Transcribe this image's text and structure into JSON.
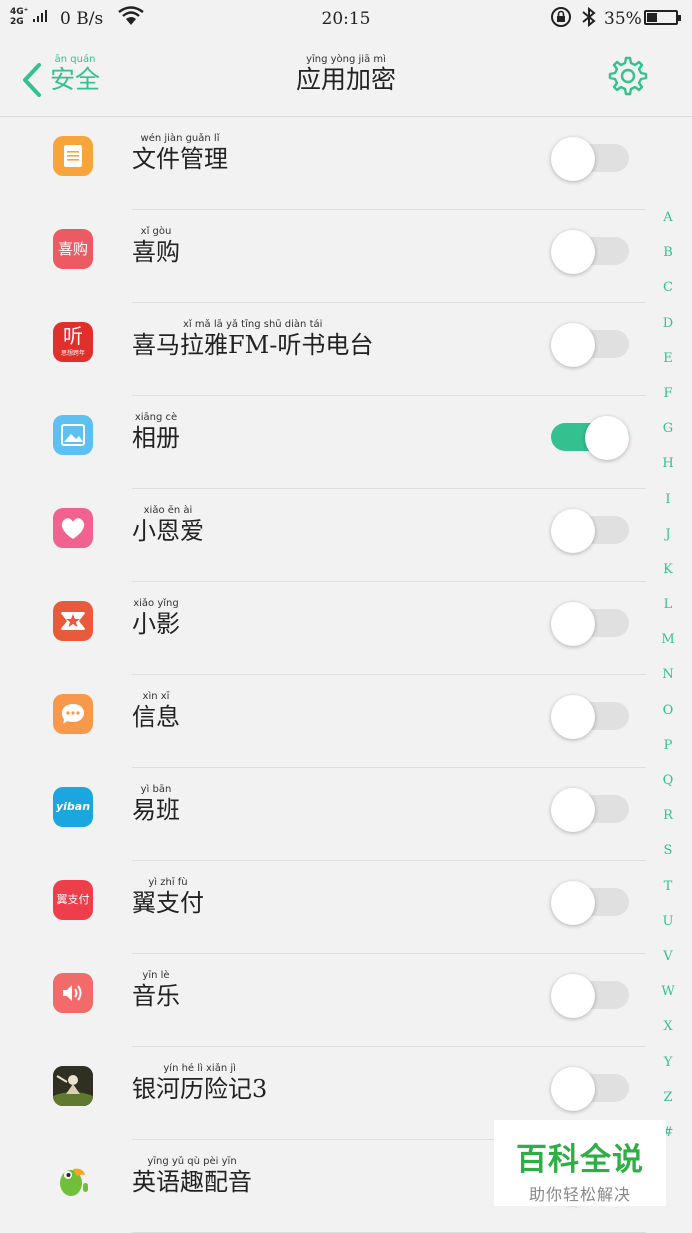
{
  "status_bar": {
    "network_top": "4G⁺",
    "network_bottom": "2G",
    "speed": "0 B/s",
    "time": "20:15",
    "battery": "35%",
    "battery_level": 0.35
  },
  "header": {
    "back_label": "安全",
    "back_pinyin": "ān quán",
    "title": "应用加密",
    "title_pinyin": "yīng yòng jiā mì",
    "accent_color": "#35c18f"
  },
  "apps": [
    {
      "name": "文件管理",
      "pinyin": "wén jiàn guǎn lǐ",
      "enabled": false,
      "icon": "file-manager-icon"
    },
    {
      "name": "喜购",
      "pinyin": "xǐ gòu",
      "enabled": false,
      "icon": "xigou-icon"
    },
    {
      "name": "喜马拉雅FM-听书电台",
      "pinyin": "xǐ mǎ lā yǎ tīng shū diàn tái",
      "enabled": false,
      "icon": "ximalaya-icon"
    },
    {
      "name": "相册",
      "pinyin": "xiāng cè",
      "enabled": true,
      "icon": "photos-icon"
    },
    {
      "name": "小恩爱",
      "pinyin": "xiǎo ēn ài",
      "enabled": false,
      "icon": "heart-icon"
    },
    {
      "name": "小影",
      "pinyin": "xiǎo yǐng",
      "enabled": false,
      "icon": "video-star-icon"
    },
    {
      "name": "信息",
      "pinyin": "xìn xī",
      "enabled": false,
      "icon": "message-icon"
    },
    {
      "name": "易班",
      "pinyin": "yì bān",
      "enabled": false,
      "icon": "yiban-icon"
    },
    {
      "name": "翼支付",
      "pinyin": "yì zhī fù",
      "enabled": false,
      "icon": "yizhifu-icon"
    },
    {
      "name": "音乐",
      "pinyin": "yīn lè",
      "enabled": false,
      "icon": "speaker-icon"
    },
    {
      "name": "银河历险记3",
      "pinyin": "yín hé lì xiǎn jì",
      "enabled": false,
      "icon": "game-icon"
    },
    {
      "name": "英语趣配音",
      "pinyin": "yīng yǔ qù pèi yīn",
      "enabled": false,
      "icon": "parrot-icon"
    }
  ],
  "icon_labels": {
    "xigou": "喜购",
    "ximalaya_main": "听",
    "ximalaya_sub": "思想跨年",
    "yiban": "yiban",
    "yizhifu": "翼支付"
  },
  "alpha_index": [
    "A",
    "B",
    "C",
    "D",
    "E",
    "F",
    "G",
    "H",
    "I",
    "J",
    "K",
    "L",
    "M",
    "N",
    "O",
    "P",
    "Q",
    "R",
    "S",
    "T",
    "U",
    "V",
    "W",
    "X",
    "Y",
    "Z",
    "#"
  ],
  "watermark": {
    "title": "百科全说",
    "subtitle": "助你轻松解决"
  }
}
